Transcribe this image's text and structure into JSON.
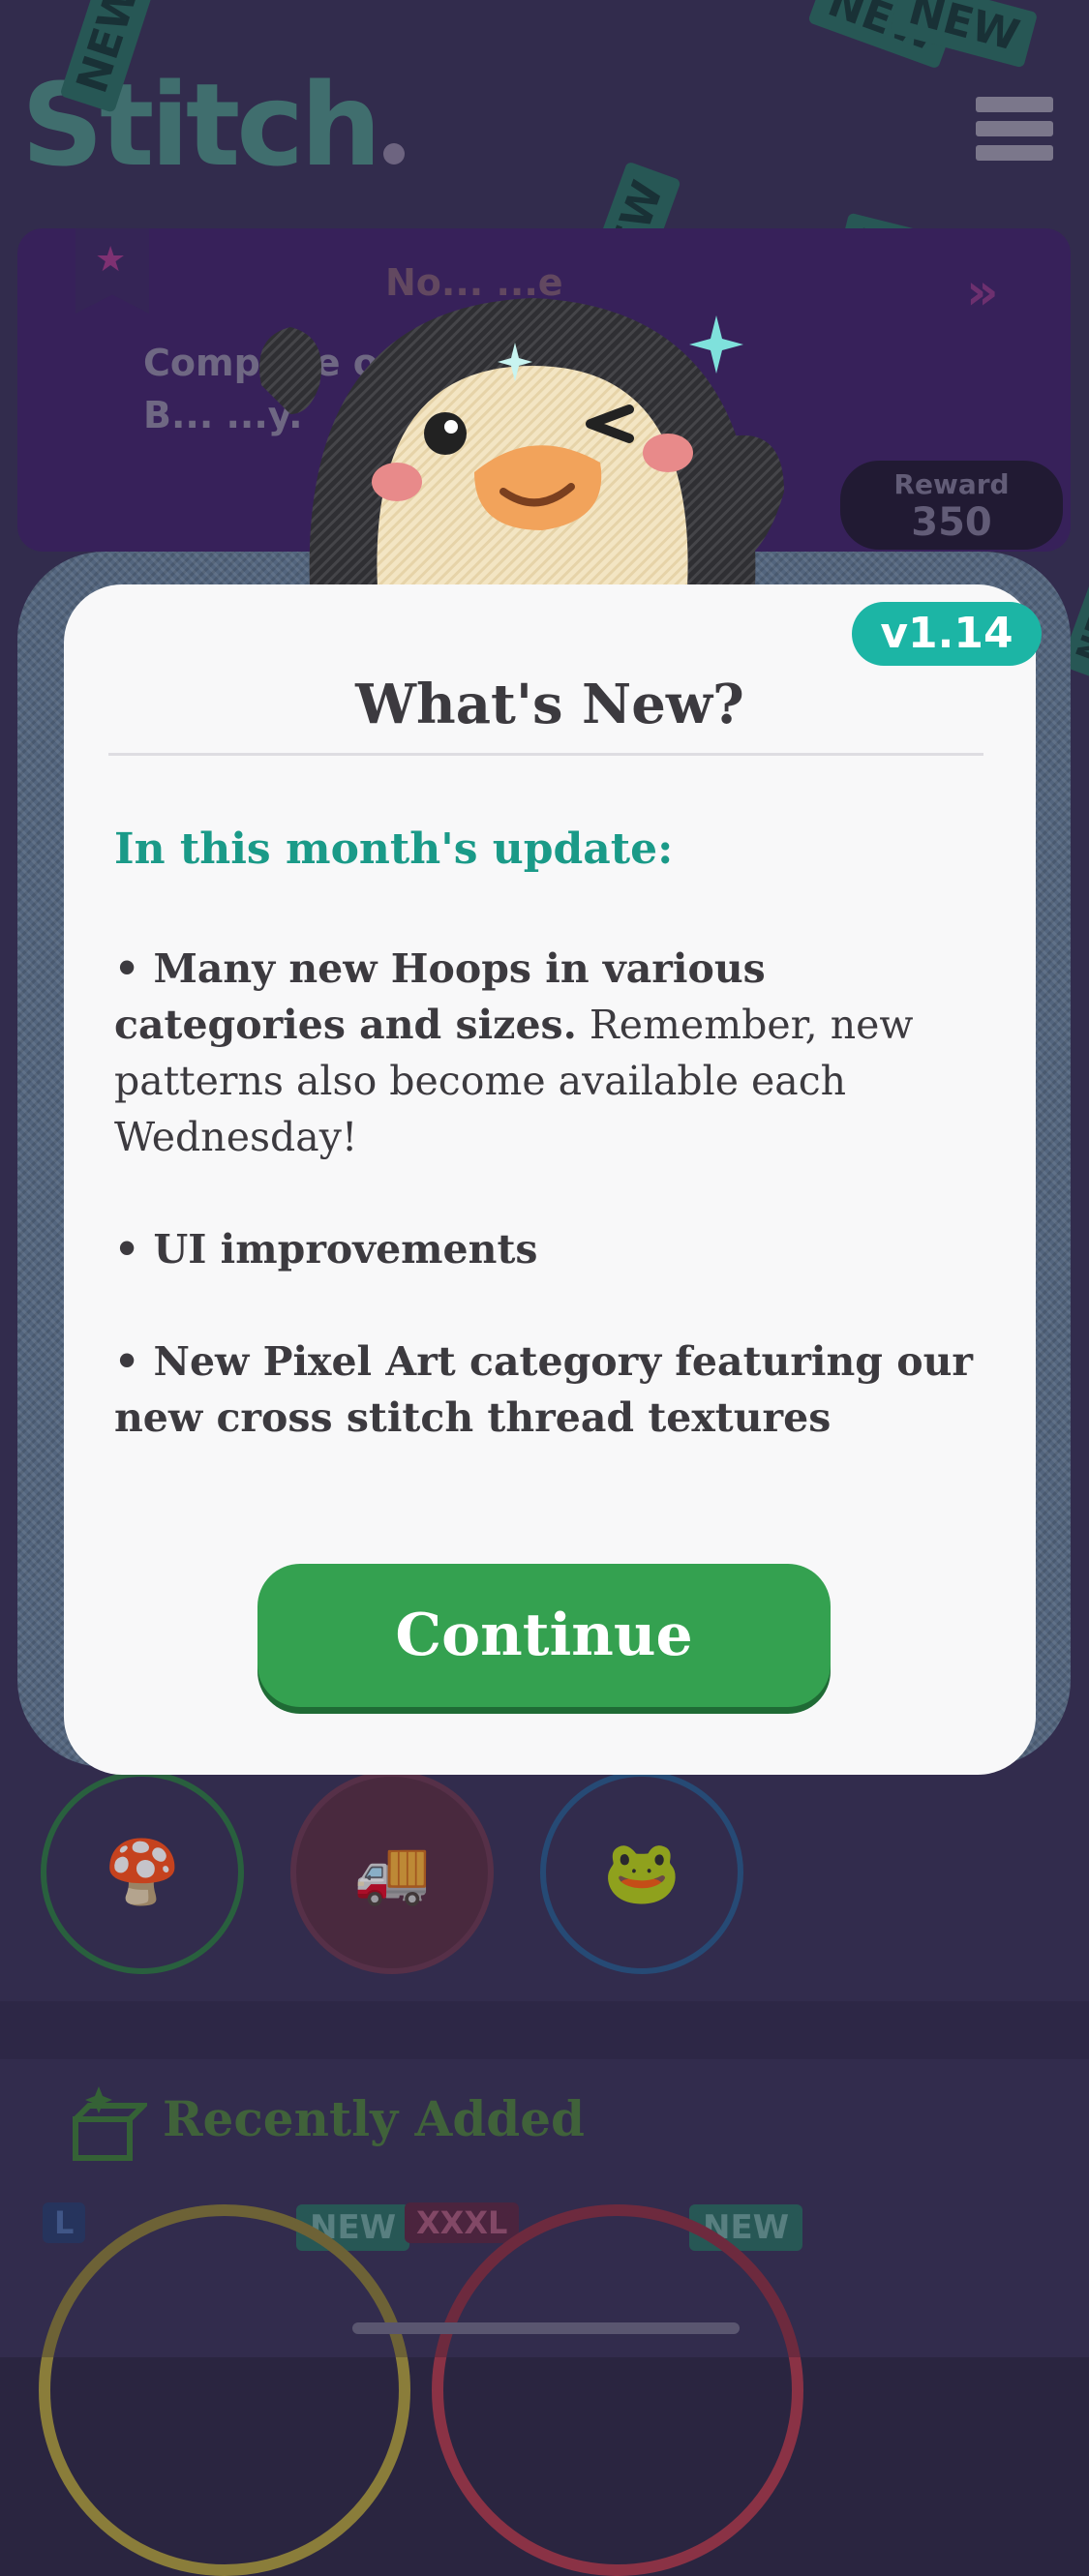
{
  "app": {
    "logo": "Stitch",
    "background_color": "#3b3458"
  },
  "header": {
    "menu_icon": "hamburger-icon"
  },
  "new_tags": [
    "NEW",
    "NEW",
    "NEW",
    "NEW",
    "NEW",
    "NEW"
  ],
  "challenge": {
    "title": "No... ...e",
    "text_line1": "Complete o... ...Hoops for",
    "text_line2": "B... ...y.",
    "reward_label": "Reward",
    "reward_value": "350"
  },
  "modal": {
    "version": "v1.14",
    "title": "What's New?",
    "subtitle": "In this month's update:",
    "bullets": [
      {
        "bold": "• Many new Hoops in various categories and sizes.",
        "regular": " Remember, new patterns also become available each Wednesday!"
      },
      {
        "bold": "• UI improvements",
        "regular": ""
      },
      {
        "bold": "• New Pixel Art category featuring our new cross stitch thread textures",
        "regular": ""
      }
    ],
    "continue_label": "Continue"
  },
  "categories": [
    {
      "icon": "mushroom-icon",
      "ring_color": "#2f7a45"
    },
    {
      "icon": "truck-icon",
      "ring_color": "#8b3d54"
    },
    {
      "icon": "frog-icon",
      "ring_color": "#2b5d8e"
    }
  ],
  "recently_added": {
    "title": "Recently Added",
    "items": [
      {
        "size": "L",
        "tag": "NEW"
      },
      {
        "size": "XXXL",
        "tag": "NEW"
      }
    ]
  }
}
